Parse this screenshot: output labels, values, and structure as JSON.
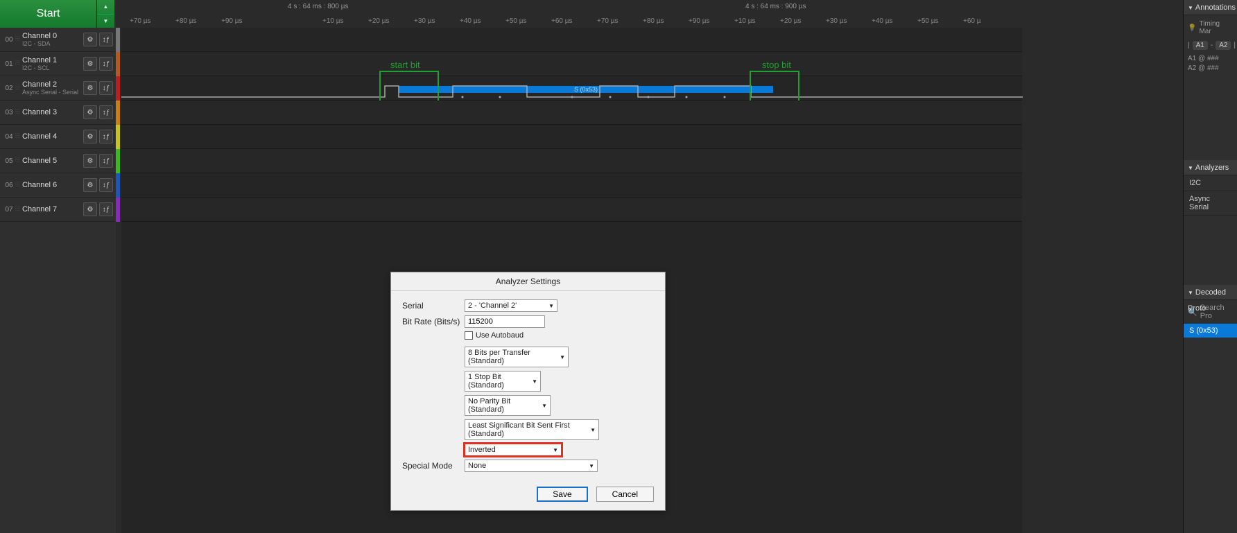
{
  "start_label": "Start",
  "channels": [
    {
      "num": "00",
      "name": "Channel 0",
      "sub": "I2C - SDA",
      "color": "#777"
    },
    {
      "num": "01",
      "name": "Channel 1",
      "sub": "I2C - SCL",
      "color": "#b35a20"
    },
    {
      "num": "02",
      "name": "Channel 2",
      "sub": "Async Serial - Serial",
      "color": "#b82020"
    },
    {
      "num": "03",
      "name": "Channel 3",
      "sub": "",
      "color": "#c97f16"
    },
    {
      "num": "04",
      "name": "Channel 4",
      "sub": "",
      "color": "#c7c420"
    },
    {
      "num": "05",
      "name": "Channel 5",
      "sub": "",
      "color": "#3cb820"
    },
    {
      "num": "06",
      "name": "Channel 6",
      "sub": "",
      "color": "#2055b8"
    },
    {
      "num": "07",
      "name": "Channel 7",
      "sub": "",
      "color": "#8a2ab8"
    }
  ],
  "timestamps": {
    "left": "4 s : 64 ms : 800 µs",
    "right": "4 s : 64 ms : 900 µs"
  },
  "ticks_left": [
    "+70 µs",
    "+80 µs",
    "+90 µs"
  ],
  "ticks_right": [
    "+10 µs",
    "+20 µs",
    "+30 µs",
    "+40 µs",
    "+50 µs",
    "+60 µs",
    "+70 µs",
    "+80 µs",
    "+90 µs",
    "+10 µs",
    "+20 µs",
    "+30 µs",
    "+40 µs",
    "+50 µs",
    "+60 µ"
  ],
  "decoded_label": "S (0x53)",
  "annot": {
    "start": "start bit",
    "stop": "stop bit"
  },
  "right_panels": {
    "annotations": "Annotations",
    "timing": "Timing Mar",
    "a1a2": {
      "a1": "A1",
      "a2": "A2",
      "dash": "-",
      "eq": "= #"
    },
    "a1row": "A1  @  ###",
    "a2row": "A2  @  ###",
    "analyzers": "Analyzers",
    "analyzer_items": [
      "I2C",
      "Async Serial"
    ],
    "decoded": "Decoded Proto",
    "search_placeholder": "Search Pro",
    "proto_item": "S (0x53)"
  },
  "dialog": {
    "title": "Analyzer Settings",
    "serial_label": "Serial",
    "serial_value": "2 - 'Channel 2'",
    "bitrate_label": "Bit Rate (Bits/s)",
    "bitrate_value": "115200",
    "autobaud": "Use Autobaud",
    "bits": "8 Bits per Transfer (Standard)",
    "stop": "1 Stop Bit (Standard)",
    "parity": "No Parity Bit (Standard)",
    "lsb": "Least Significant Bit Sent First (Standard)",
    "inverted": "Inverted",
    "special_label": "Special Mode",
    "special_value": "None",
    "save": "Save",
    "cancel": "Cancel"
  }
}
